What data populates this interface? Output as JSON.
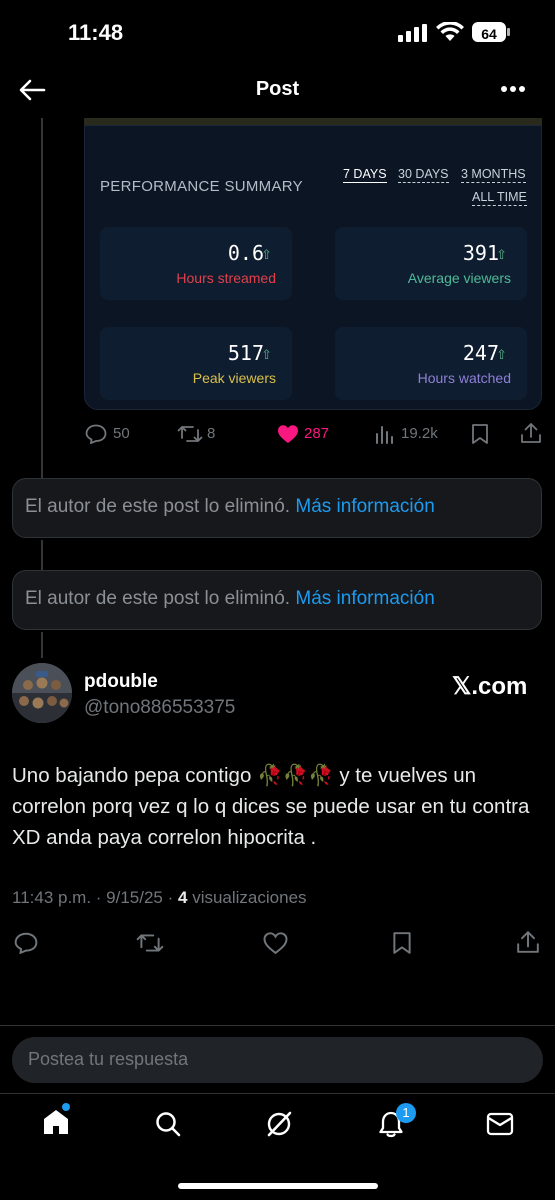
{
  "status_bar": {
    "time": "11:48",
    "battery": "64"
  },
  "header": {
    "title": "Post"
  },
  "perf_card": {
    "title": "PERFORMANCE SUMMARY",
    "ranges": [
      "7 DAYS",
      "30 DAYS",
      "3 MONTHS",
      "ALL TIME"
    ],
    "active_range": "7 DAYS",
    "metrics": [
      {
        "value": "0.6",
        "label": "Hours streamed",
        "color": "#e0404a"
      },
      {
        "value": "391",
        "label": "Average viewers",
        "color": "#4dbb98"
      },
      {
        "value": "517",
        "label": "Peak viewers",
        "color": "#d9c04a"
      },
      {
        "value": "247",
        "label": "Hours watched",
        "color": "#8e7fd6"
      }
    ]
  },
  "card_actions": {
    "replies": "50",
    "reposts": "8",
    "likes": "287",
    "views": "19.2k"
  },
  "deleted_posts": [
    {
      "text": "El autor de este post lo eliminó.",
      "link": "Más información"
    },
    {
      "text": "El autor de este post lo eliminó.",
      "link": "Más información"
    }
  ],
  "post": {
    "author_name": "pdouble",
    "author_handle": "@tono886553375",
    "source": "𝕏.com",
    "text": "Uno bajando pepa contigo 🥀🥀🥀 y te vuelves un correlon porq vez q lo q dices se puede usar en tu contra XD anda paya correlon hipocrita .",
    "timestamp": "11:43 p.m. · 9/15/25 · ",
    "views_count": "4",
    "views_label": " visualizaciones"
  },
  "reply": {
    "placeholder": "Postea tu respuesta"
  },
  "nav": {
    "notifications_badge": "1"
  },
  "colors": {
    "accent": "#1d9bf0",
    "like": "#f91880",
    "background": "#000000"
  }
}
